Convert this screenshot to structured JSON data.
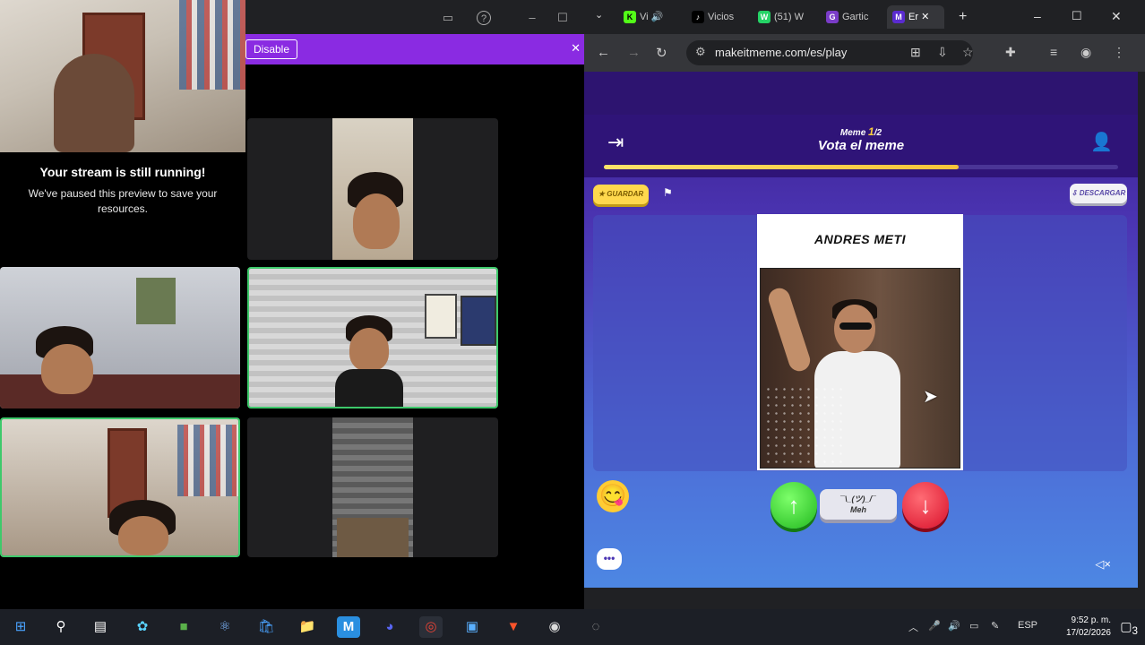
{
  "stream_notice": {
    "title": "Your stream is still running!",
    "body": "We've paused this preview to save your resources."
  },
  "call_app": {
    "disable_label": "Disable"
  },
  "browser": {
    "tabs": [
      {
        "label": "Vi",
        "favicon": "K"
      },
      {
        "label": "Vicios",
        "favicon": "♪"
      },
      {
        "label": "(51) W",
        "favicon": "W"
      },
      {
        "label": "Gartic",
        "favicon": "G"
      },
      {
        "label": "Er",
        "favicon": "M"
      }
    ],
    "url": "makeitmeme.com/es/play"
  },
  "game": {
    "meme_label": "Meme",
    "meme_index": "1",
    "meme_total": "/2",
    "title": "Vota el meme",
    "progress_fraction": 0.69,
    "save_label": "GUARDAR",
    "download_label": "DESCARGAR",
    "meme_caption": "ANDRES METI",
    "meh_top": "¯\\_(ツ)_/¯",
    "meh_label": "Meh"
  },
  "taskbar": {
    "language": "ESP",
    "time": "9:52 p. m.",
    "date": "17/02/2026",
    "notification_count": "3"
  },
  "colors": {
    "accent_purple": "#8a2be2",
    "vote_up": "#21b81e",
    "vote_down": "#d9102a",
    "speaker_border": "#3ec96b"
  }
}
